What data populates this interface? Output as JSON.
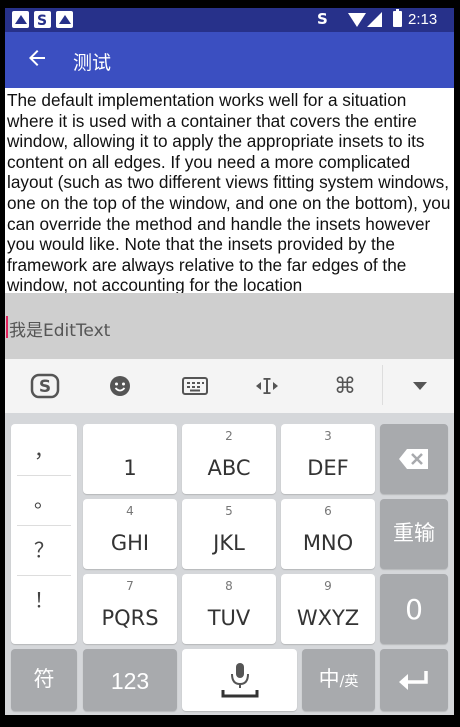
{
  "status_bar": {
    "time": "2:13",
    "icons": [
      "notification-icon",
      "sogou-icon",
      "notification-icon",
      "sogou-icon",
      "wifi-icon",
      "signal-icon",
      "battery-icon"
    ]
  },
  "app_bar": {
    "title": "测试",
    "back_icon": "arrow-left-icon"
  },
  "content": {
    "body": "The default implementation works well for a situation where it is used with a container that covers the entire window, allowing it to apply the appropriate insets to its content on all edges. If you need a more complicated layout (such as two different views fitting system windows, one on the top of the window, and one on the bottom), you can override the method and handle the insets however you would like. Note that the insets provided by the framework are always relative to the far edges of the window, not accounting for the location"
  },
  "edit_text": {
    "value": "我是EditText"
  },
  "ime_toolbar": {
    "items": [
      "sogou-logo-icon",
      "emoji-icon",
      "keyboard-icon",
      "cursor-move-icon",
      "command-icon",
      "collapse-icon"
    ]
  },
  "keyboard": {
    "punctuation": [
      "，",
      "。",
      "？",
      "！"
    ],
    "keys": {
      "k1": {
        "main": "1",
        "sub": ""
      },
      "k2": {
        "main": "ABC",
        "sub": "2"
      },
      "k3": {
        "main": "DEF",
        "sub": "3"
      },
      "k4": {
        "main": "GHI",
        "sub": "4"
      },
      "k5": {
        "main": "JKL",
        "sub": "5"
      },
      "k6": {
        "main": "MNO",
        "sub": "6"
      },
      "k7": {
        "main": "PQRS",
        "sub": "7"
      },
      "k8": {
        "main": "TUV",
        "sub": "8"
      },
      "k9": {
        "main": "WXYZ",
        "sub": "9"
      }
    },
    "reinput": "重输",
    "zero": "0",
    "symbols": "符",
    "numbers": "123",
    "lang_cn": "中",
    "lang_en": "/英"
  }
}
